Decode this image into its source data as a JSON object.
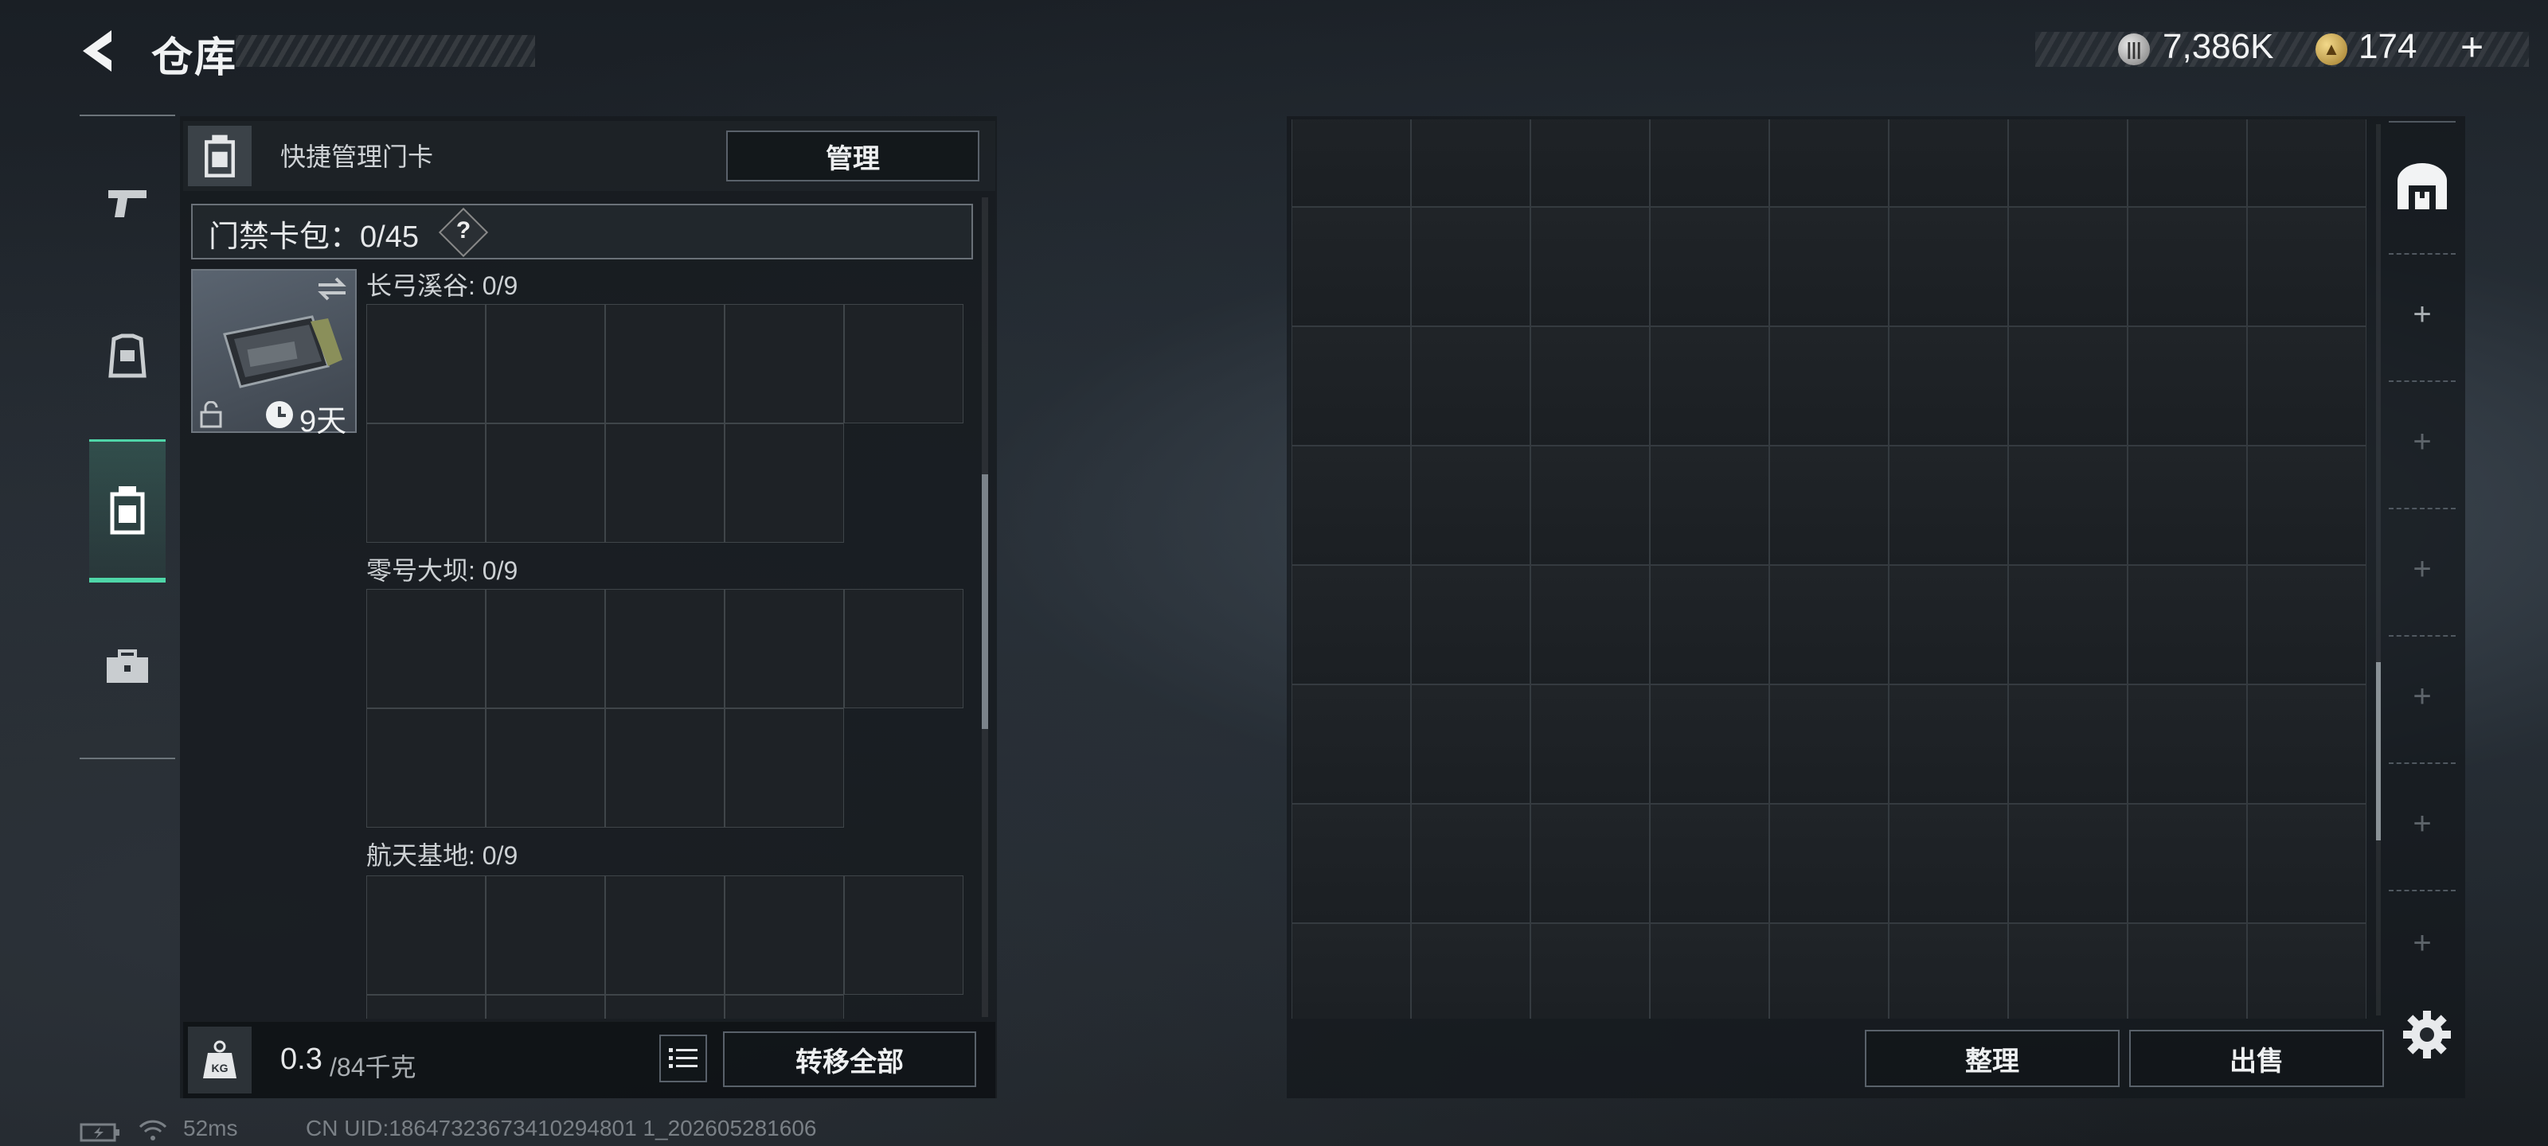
{
  "header": {
    "title": "仓库",
    "currency_1": "7,386K",
    "currency_2": "174",
    "add_symbol": "+"
  },
  "tabs": [
    {
      "name": "weapons-tab",
      "icon": "pistol-icon",
      "active": false
    },
    {
      "name": "gear-tab",
      "icon": "vest-icon",
      "active": false
    },
    {
      "name": "keycard-tab",
      "icon": "keycard-icon",
      "active": true
    },
    {
      "name": "supplies-tab",
      "icon": "briefcase-icon",
      "active": false
    }
  ],
  "left_panel": {
    "quick_manage_label": "快捷管理门卡",
    "manage_button": "管理",
    "cardbag_label": "门禁卡包：0/45",
    "help_symbol": "?",
    "item": {
      "duration": "9天",
      "icons": [
        "swap-icon",
        "lock-icon",
        "clock-icon"
      ]
    },
    "sections": [
      {
        "label": "长弓溪谷: 0/9"
      },
      {
        "label": "零号大坝: 0/9"
      },
      {
        "label": "航天基地: 0/9"
      }
    ],
    "weight_value": "0.3",
    "weight_max": "/84千克",
    "transfer_all_button": "转移全部"
  },
  "right_panel": {
    "arrange_button": "整理",
    "sell_button": "出售"
  },
  "status_bar": {
    "ping": "52ms",
    "uid": "CN UID:18647323673410294801 1_202605281606"
  },
  "colors": {
    "accent": "#4fd6a8",
    "panel": "#1d2125",
    "border": "#59616a"
  }
}
